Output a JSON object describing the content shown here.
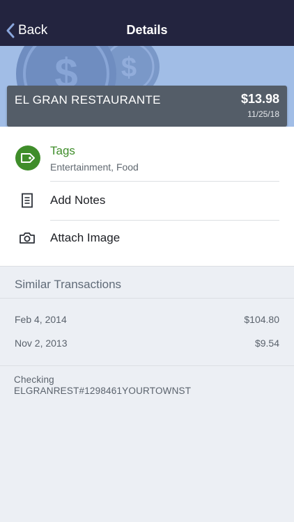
{
  "nav": {
    "back_label": "Back",
    "title": "Details"
  },
  "transaction": {
    "merchant": "EL GRAN RESTAURANTE",
    "amount": "$13.98",
    "date": "11/25/18"
  },
  "details": {
    "tags_label": "Tags",
    "tags_value": "Entertainment, Food",
    "notes_label": "Add Notes",
    "image_label": "Attach Image"
  },
  "similar": {
    "title": "Similar Transactions",
    "items": [
      {
        "date": "Feb 4, 2014",
        "amount": "$104.80"
      },
      {
        "date": "Nov 2, 2013",
        "amount": "$9.54"
      }
    ]
  },
  "account": {
    "name": "Checking",
    "description": "ELGRANREST#1298461YOURTOWNST"
  },
  "colors": {
    "nav_bg": "#23243f",
    "hero_bg": "#a1bde6",
    "accent_green": "#3f8d2a",
    "merchant_bar": "#545d68"
  },
  "icons": [
    "chevron-left-icon",
    "money-coins-illustration",
    "tag-icon",
    "document-icon",
    "camera-icon"
  ]
}
